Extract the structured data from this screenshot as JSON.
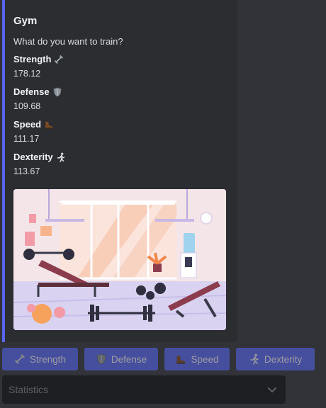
{
  "embed": {
    "title": "Gym",
    "description": "What do you want to train?",
    "accent_color": "#5865f2",
    "fields": [
      {
        "name": "Strength",
        "value": "178.12",
        "icon": "dumbbell-icon"
      },
      {
        "name": "Defense",
        "value": "109.68",
        "icon": "shield-icon"
      },
      {
        "name": "Speed",
        "value": "111.17",
        "icon": "boot-icon"
      },
      {
        "name": "Dexterity",
        "value": "113.67",
        "icon": "runner-icon"
      }
    ]
  },
  "buttons": [
    {
      "label": "Strength",
      "icon": "dumbbell-icon"
    },
    {
      "label": "Defense",
      "icon": "shield-icon"
    },
    {
      "label": "Speed",
      "icon": "boot-icon"
    },
    {
      "label": "Dexterity",
      "icon": "runner-icon"
    }
  ],
  "select": {
    "placeholder": "Statistics"
  }
}
